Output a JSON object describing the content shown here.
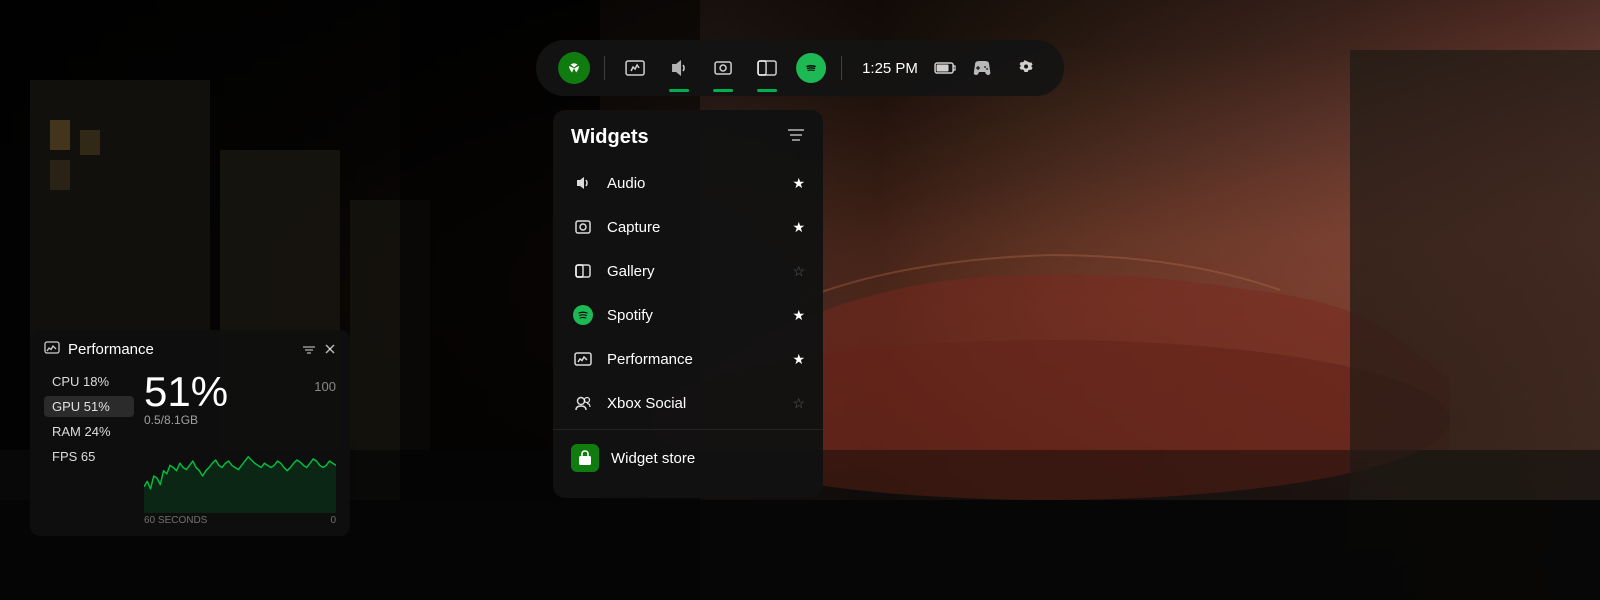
{
  "background": {
    "color_left": "#080808",
    "color_right": "#c07060"
  },
  "topbar": {
    "time": "1:25 PM",
    "icons": [
      {
        "name": "xbox",
        "label": "Xbox",
        "active": false
      },
      {
        "name": "performance",
        "label": "Performance",
        "active": false
      },
      {
        "name": "audio",
        "label": "Audio",
        "active": true
      },
      {
        "name": "capture",
        "label": "Capture",
        "active": true
      },
      {
        "name": "gallery",
        "label": "Gallery",
        "active": true
      },
      {
        "name": "spotify",
        "label": "Spotify",
        "active": false
      }
    ],
    "battery_icon": "🔋",
    "controller_icon": "🎮",
    "settings_icon": "⚙"
  },
  "widgets_panel": {
    "title": "Widgets",
    "items": [
      {
        "id": "audio",
        "label": "Audio",
        "starred": true,
        "icon": "audio"
      },
      {
        "id": "capture",
        "label": "Capture",
        "starred": true,
        "icon": "capture"
      },
      {
        "id": "gallery",
        "label": "Gallery",
        "starred": false,
        "icon": "gallery"
      },
      {
        "id": "spotify",
        "label": "Spotify",
        "starred": true,
        "icon": "spotify"
      },
      {
        "id": "performance",
        "label": "Performance",
        "starred": true,
        "icon": "performance"
      },
      {
        "id": "xbox-social",
        "label": "Xbox Social",
        "starred": false,
        "icon": "social"
      }
    ],
    "store_item": {
      "label": "Widget store",
      "icon": "store"
    }
  },
  "performance_widget": {
    "title": "Performance",
    "stats": [
      {
        "label": "CPU 18%",
        "active": false
      },
      {
        "label": "GPU 51%",
        "active": true
      },
      {
        "label": "RAM 24%",
        "active": false
      },
      {
        "label": "FPS 65",
        "active": false
      }
    ],
    "main_value": "51%",
    "max_value": "100",
    "sub_value": "0.5/8.1GB",
    "chart_label_left": "60 SECONDS",
    "chart_label_right": "0",
    "chart_data": [
      20,
      25,
      18,
      30,
      28,
      22,
      35,
      32,
      40,
      38,
      35,
      42,
      38,
      36,
      40,
      44,
      38,
      35,
      30,
      35,
      38,
      42,
      45,
      40,
      38,
      42,
      44,
      40,
      38,
      36,
      40,
      44,
      48,
      45,
      42,
      40,
      38,
      42,
      40,
      38,
      40,
      44,
      42,
      38,
      35,
      38,
      42,
      45,
      43,
      40,
      38,
      42,
      46,
      44,
      40,
      38,
      40,
      44,
      42,
      40
    ]
  }
}
